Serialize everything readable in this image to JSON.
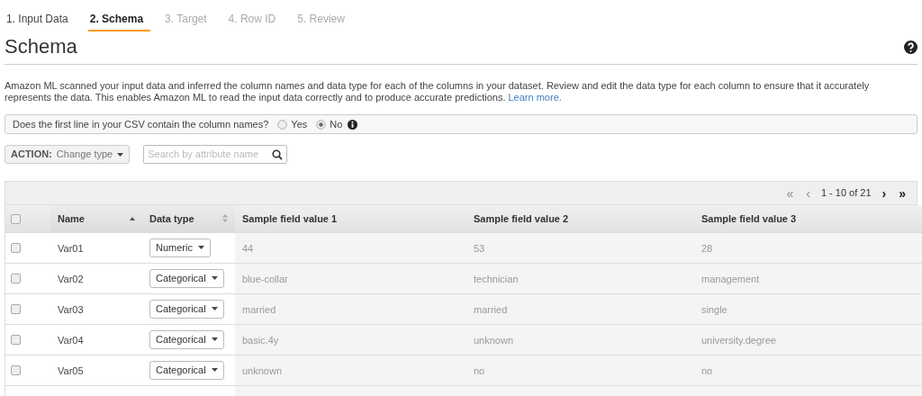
{
  "steps": [
    {
      "label": "1. Input Data",
      "selected": false,
      "disabled": false
    },
    {
      "label": "2. Schema",
      "selected": true,
      "disabled": false
    },
    {
      "label": "3. Target",
      "selected": false,
      "disabled": true
    },
    {
      "label": "4. Row ID",
      "selected": false,
      "disabled": true
    },
    {
      "label": "5. Review",
      "selected": false,
      "disabled": true
    }
  ],
  "title": "Schema",
  "description": {
    "text": "Amazon ML scanned your input data and inferred the column names and data type for each of the columns in your dataset. Review and edit the data type for each column to ensure that it accurately represents the data. This enables Amazon ML to read the input data correctly and to produce accurate predictions.",
    "link": "Learn more."
  },
  "header_question": {
    "text": "Does the first line in your CSV contain the column names?",
    "options": [
      {
        "label": "Yes",
        "selected": false
      },
      {
        "label": "No",
        "selected": true
      }
    ]
  },
  "action": {
    "label": "ACTION:",
    "value": "Change type"
  },
  "search": {
    "placeholder": "Search by attribute name"
  },
  "pager": {
    "first": {
      "glyph": "«",
      "disabled": true
    },
    "prev": {
      "glyph": "‹",
      "disabled": true
    },
    "range": "1 - 10 of 21",
    "next": {
      "glyph": "›",
      "disabled": false
    },
    "last": {
      "glyph": "»",
      "disabled": false
    }
  },
  "table": {
    "select_all": {
      "checked": false
    },
    "columns": [
      {
        "label": "Name",
        "sortable": true,
        "sorted": true
      },
      {
        "label": "Data type",
        "sortable": true,
        "sorted": false
      },
      {
        "label": "Sample field value 1"
      },
      {
        "label": "Sample field value 2"
      },
      {
        "label": "Sample field value 3"
      }
    ],
    "rows": [
      {
        "checked": false,
        "name": "Var01",
        "type": "Numeric",
        "samples": [
          "44",
          "53",
          "28"
        ]
      },
      {
        "checked": false,
        "name": "Var02",
        "type": "Categorical",
        "samples": [
          "blue-collar",
          "technician",
          "management"
        ]
      },
      {
        "checked": false,
        "name": "Var03",
        "type": "Categorical",
        "samples": [
          "married",
          "married",
          "single"
        ]
      },
      {
        "checked": false,
        "name": "Var04",
        "type": "Categorical",
        "samples": [
          "basic.4y",
          "unknown",
          "university.degree"
        ]
      },
      {
        "checked": false,
        "name": "Var05",
        "type": "Categorical",
        "samples": [
          "unknown",
          "no",
          "no"
        ]
      }
    ]
  }
}
